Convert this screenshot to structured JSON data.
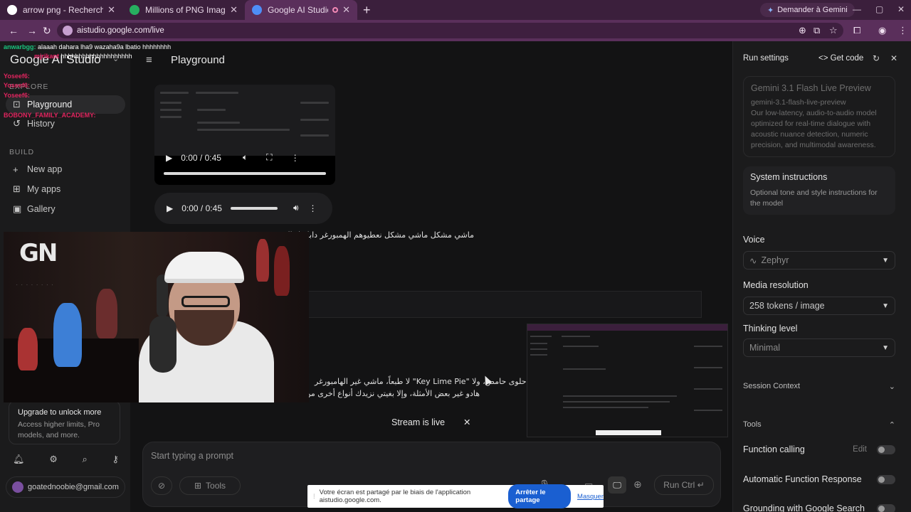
{
  "browser": {
    "tabs": [
      {
        "label": "arrow png - Recherche Google",
        "favicon_color": "#ffffff",
        "active": false
      },
      {
        "label": "Millions of PNG Images, Backgr",
        "favicon_color": "#27ae60",
        "active": false
      },
      {
        "label": "Google AI Studio",
        "favicon_color": "#4e8ef7",
        "active": true
      }
    ],
    "new_tab": "+",
    "gemini_button": "Demander à Gemini",
    "url": "aistudio.google.com/live",
    "window_controls": [
      "—",
      "▢",
      "✕"
    ]
  },
  "sidebar": {
    "brand": "Google AI Studio",
    "sections": {
      "explore": "EXPLORE",
      "build": "BUILD"
    },
    "items": [
      {
        "label": "Playground",
        "icon": "playground-icon",
        "active": true
      },
      {
        "label": "History",
        "icon": "history-icon",
        "active": false
      },
      {
        "label": "New app",
        "icon": "plus-icon",
        "active": false
      },
      {
        "label": "My apps",
        "icon": "grid-icon",
        "active": false
      },
      {
        "label": "Gallery",
        "icon": "gallery-icon",
        "active": false
      }
    ],
    "upgrade": {
      "title": "Upgrade to unlock more",
      "description": "Access higher limits, Pro models, and more."
    },
    "footer_icons": [
      "bell-icon",
      "gear-icon",
      "search-icon",
      "key-icon"
    ],
    "account_email": "goatednoobie@gmail.com"
  },
  "main": {
    "title": "Playground",
    "video_time": "0:00 / 0:45",
    "audio_time": "0:00 / 0:45",
    "user_message": "ماشي مشكل ماشي مشكل نعطيوهم الهمبورغر دابا هاد الهمبور",
    "response_line1": "لي هي حلوى حامض، ولا \"Key Lime Pie\" لا طبعاً، ماشي غير الهامبورغر",
    "response_line2": "هادو غير بعض الأمثلة، وإلا بغيتي نزيدك أنواع أخرى من الأطـ.",
    "stream_status": "Stream is live",
    "prompt_placeholder": "Start typing a prompt",
    "tools_button": "Tools",
    "run_button": "Run Ctrl ↵"
  },
  "run_settings": {
    "title": "Run settings",
    "get_code": "Get code",
    "model": {
      "name": "Gemini 3.1 Flash Live Preview",
      "id": "gemini-3.1-flash-live-preview",
      "description": "Our low-latency, audio-to-audio model optimized for real-time dialogue with acoustic nuance detection, numeric precision, and multimodal awareness."
    },
    "system_instructions": {
      "title": "System instructions",
      "description": "Optional tone and style instructions for the model"
    },
    "voice": {
      "label": "Voice",
      "value": "Zephyr"
    },
    "media_resolution": {
      "label": "Media resolution",
      "value": "258 tokens / image"
    },
    "thinking_level": {
      "label": "Thinking level",
      "value": "Minimal"
    },
    "session_context": "Session Context",
    "tools_header": "Tools",
    "tools": [
      {
        "label": "Function calling",
        "edit": "Edit",
        "enabled": false
      },
      {
        "label": "Automatic Function Response",
        "enabled": false
      },
      {
        "label": "Grounding with Google Search",
        "enabled": false
      }
    ]
  },
  "stream_overlay": {
    "chat": [
      {
        "user": "anwarbgg:",
        "text": "alaaah dahara lha9 wazaha9a lbatio hhhhhhhh",
        "color": "#19c37d"
      },
      {
        "user": "mjrikant",
        "text": "hhhhhhhhhhhhhhhhhhhh",
        "color": "#e91e63"
      },
      {
        "user": "Yoseef6:",
        "text": "",
        "color": "#e0245e"
      },
      {
        "user": "Yoseef6:",
        "text": "",
        "color": "#e0245e"
      },
      {
        "user": "Yoseef6:",
        "text": "",
        "color": "#e0245e"
      },
      {
        "user": "BOBONY_FAMILY_ACADEMY:",
        "text": "",
        "color": "#e0245e"
      }
    ],
    "share_notice": "Votre écran est partagé par le biais de l'application aistudio.google.com.",
    "stop_sharing": "Arrêter le partage",
    "hide": "Masquer"
  },
  "colors": {
    "tab_bar": "#3b1f3c",
    "address_bar": "#5a2f5b",
    "app_bg": "#131314",
    "panel_bg": "#1b1b1c",
    "accent_blue": "#1a5fd1"
  }
}
